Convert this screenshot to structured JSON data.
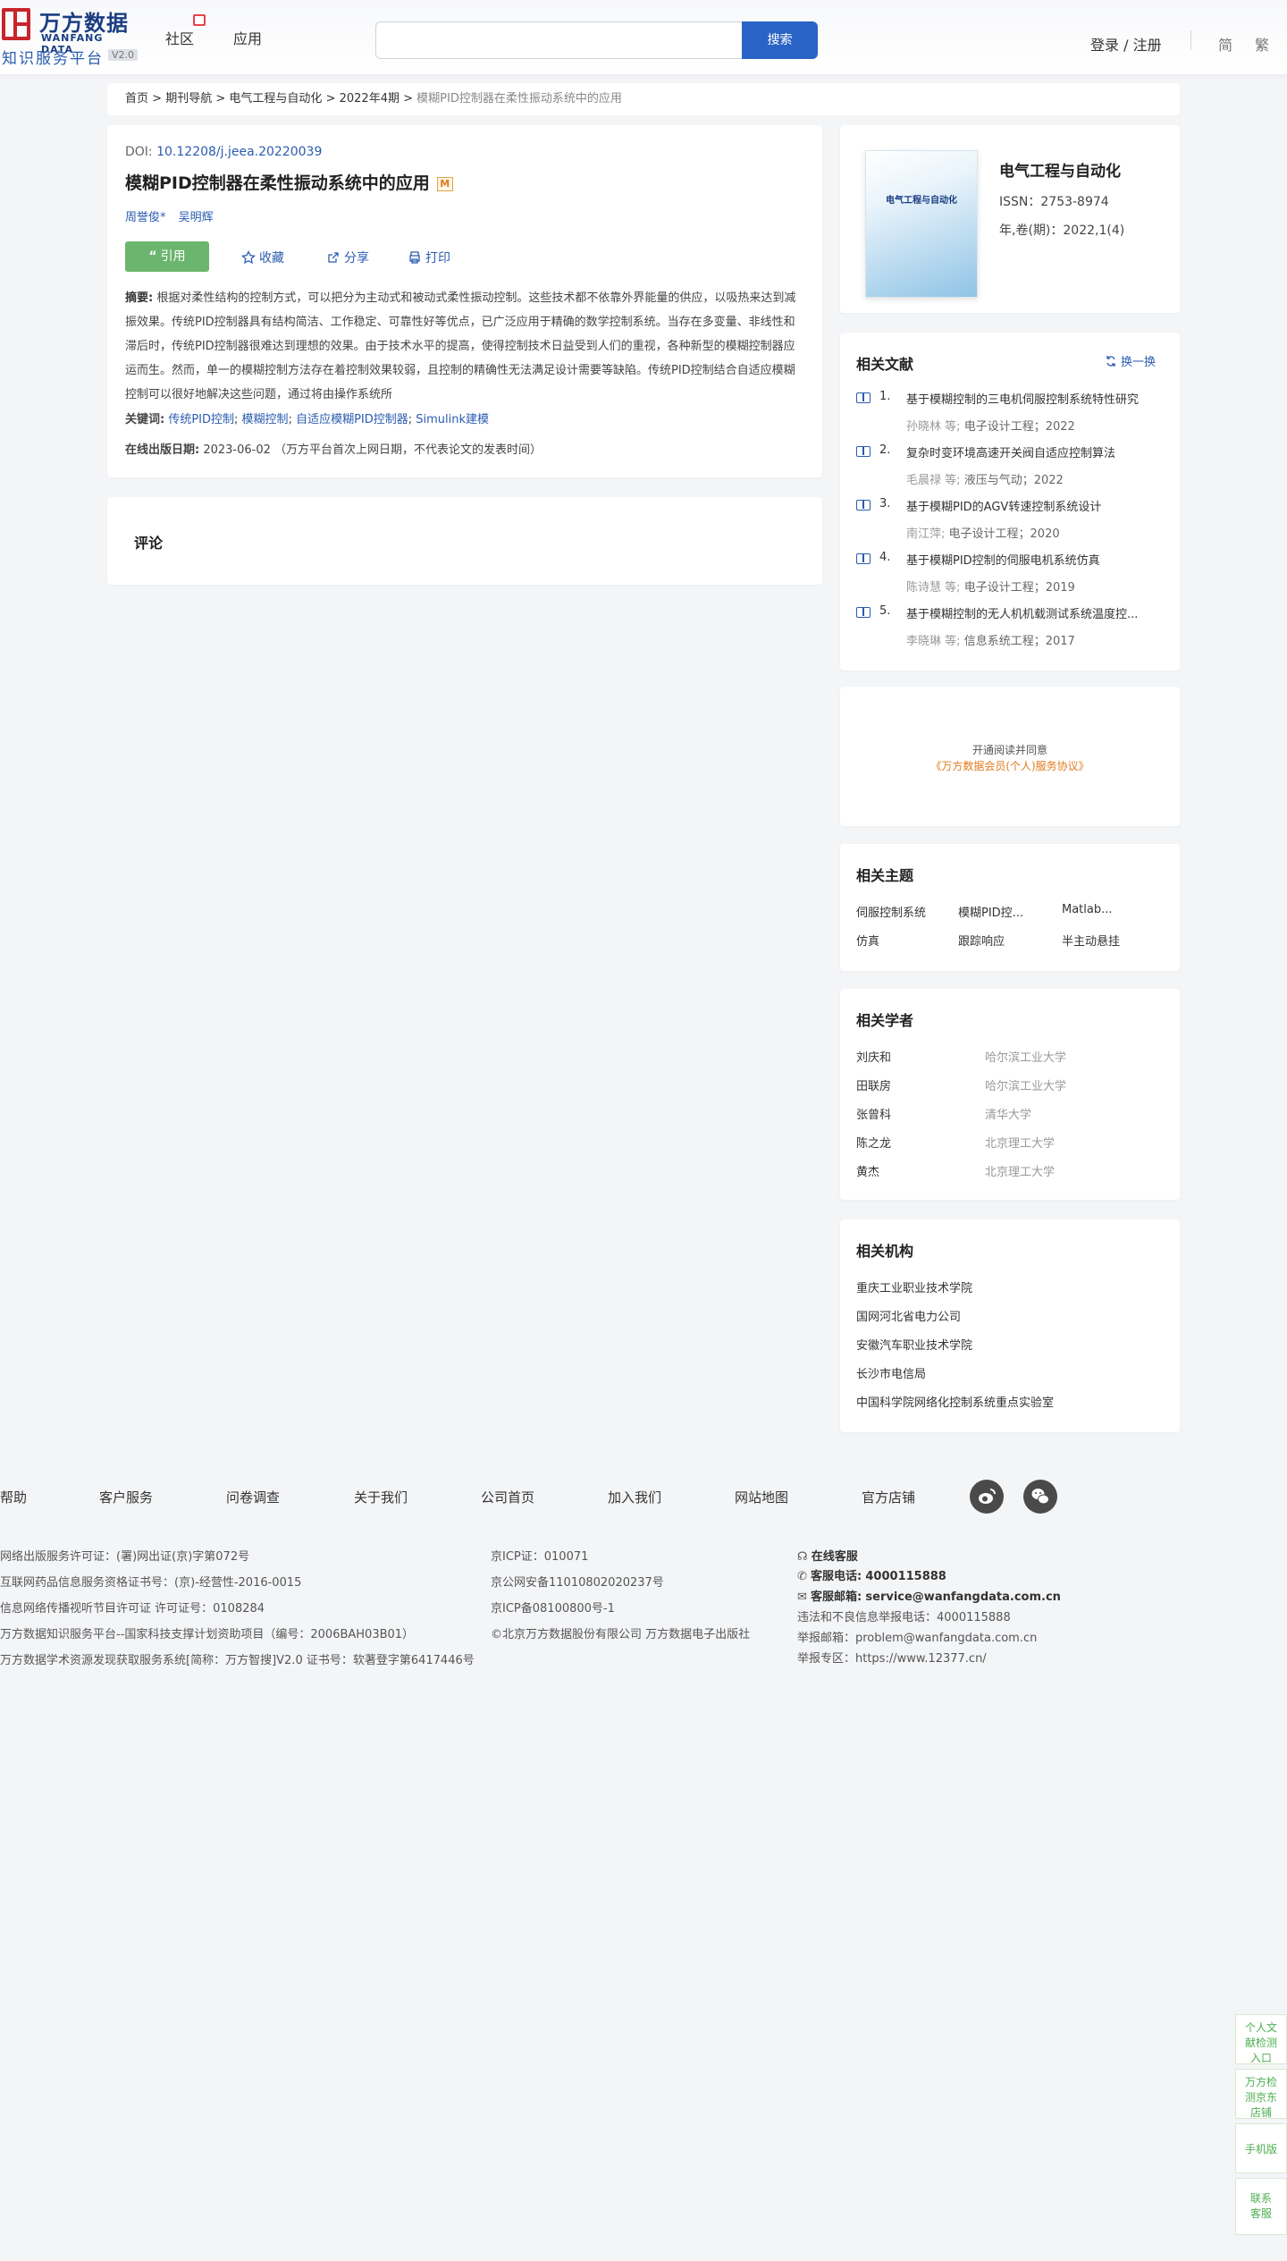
{
  "header": {
    "logo_cn": "万方数据",
    "logo_en": "WANFANG DATA",
    "logo_sub": "知识服务平台",
    "logo_version": "V2.0",
    "nav": [
      "社区",
      "应用"
    ],
    "search_placeholder": "",
    "search_button": "搜索",
    "login": "登录 / 注册",
    "lang_simplified": "简",
    "lang_traditional": "繁"
  },
  "breadcrumb": {
    "items": [
      "首页",
      "期刊导航",
      "电气工程与自动化",
      "2022年4期"
    ],
    "separator": ">",
    "current": "模糊PID控制器在柔性振动系统中的应用"
  },
  "article": {
    "doi_label": "DOI:",
    "doi": "10.12208/j.jeea.20220039",
    "title": "模糊PID控制器在柔性振动系统中的应用",
    "title_mark": "M",
    "authors": [
      "周誉俊*",
      "吴明辉"
    ],
    "actions": {
      "cite": "引用",
      "favorite": "收藏",
      "share": "分享",
      "print": "打印"
    },
    "abstract_label": "摘要:",
    "abstract": "根据对柔性结构的控制方式，可以把分为主动式和被动式柔性振动控制。这些技术都不依靠外界能量的供应，以吸热来达到减振效果。传统PID控制器具有结构简洁、工作稳定、可靠性好等优点，已广泛应用于精确的数学控制系统。当存在多变量、非线性和滞后时，传统PID控制器很难达到理想的效果。由于技术水平的提高，使得控制技术日益受到人们的重视，各种新型的模糊控制器应运而生。然而，单一的模糊控制方法存在着控制效果较弱，且控制的精确性无法满足设计需要等缺陷。传统PID控制结合自适应模糊控制可以很好地解决这些问题，通过将由操作系统所",
    "keywords_label": "关键词:",
    "keywords": [
      "传统PID控制",
      "模糊控制",
      "自适应模糊PID控制器",
      "Simulink建模"
    ],
    "pub_label": "在线出版日期:",
    "pub_date": "2023-06-02",
    "pub_note": "（万方平台首次上网日期，不代表论文的发表时间）"
  },
  "comments": {
    "title": "评论"
  },
  "journal": {
    "cover_text": "电气工程与自动化",
    "name": "电气工程与自动化",
    "issn": "ISSN：2753-8974",
    "volume": "年,卷(期)：2022,1(4)"
  },
  "related_docs": {
    "title": "相关文献",
    "swap": "换一换",
    "items": [
      {
        "num": "1.",
        "title": "基于模糊控制的三电机伺服控制系统特性研究",
        "author": "孙晓林",
        "etal": "等;",
        "source": "电子设计工程；2022"
      },
      {
        "num": "2.",
        "title": "复杂时变环境高速开关阀自适应控制算法",
        "author": "毛晨禄",
        "etal": "等;",
        "source": "液压与气动；2022"
      },
      {
        "num": "3.",
        "title": "基于模糊PID的AGV转速控制系统设计",
        "author": "南江萍;",
        "etal": "",
        "source": "电子设计工程；2020"
      },
      {
        "num": "4.",
        "title": "基于模糊PID控制的伺服电机系统仿真",
        "author": "陈诗慧",
        "etal": "等;",
        "source": "电子设计工程；2019"
      },
      {
        "num": "5.",
        "title": "基于模糊控制的无人机机载测试系统温度控...",
        "author": "李晓琳",
        "etal": "等;",
        "source": "信息系统工程；2017"
      }
    ]
  },
  "promo": {
    "line1": "开通阅读并同意",
    "line2": "《万方数据会员(个人)服务协议》"
  },
  "topics": {
    "title": "相关主题",
    "items": [
      "伺服控制系统",
      "模糊PID控...",
      "Matlab...",
      "仿真",
      "跟踪响应",
      "半主动悬挂"
    ]
  },
  "scholars": {
    "title": "相关学者",
    "items": [
      {
        "name": "刘庆和",
        "org": "哈尔滨工业大学"
      },
      {
        "name": "田联房",
        "org": "哈尔滨工业大学"
      },
      {
        "name": "张曾科",
        "org": "清华大学"
      },
      {
        "name": "陈之龙",
        "org": "北京理工大学"
      },
      {
        "name": "黄杰",
        "org": "北京理工大学"
      }
    ]
  },
  "institutions": {
    "title": "相关机构",
    "items": [
      "重庆工业职业技术学院",
      "国网河北省电力公司",
      "安徽汽车职业技术学院",
      "长沙市电信局",
      "中国科学院网络化控制系统重点实验室"
    ]
  },
  "footer": {
    "links": [
      "帮助",
      "客户服务",
      "问卷调查",
      "关于我们",
      "公司首页",
      "加入我们",
      "网站地图",
      "官方店铺"
    ],
    "col1": [
      "网络出版服务许可证：(署)网出证(京)字第072号",
      "互联网药品信息服务资格证书号：(京)-经营性-2016-0015",
      "信息网络传播视听节目许可证 许可证号：0108284",
      "万方数据知识服务平台--国家科技支撑计划资助项目（编号：2006BAH03B01）",
      "万方数据学术资源发现获取服务系统[简称：万方智搜]V2.0 证书号：软著登字第6417446号"
    ],
    "col2": [
      "京ICP证：010071",
      "京公网安备11010802020237号",
      "京ICP备08100800号-1",
      "©北京万方数据股份有限公司 万方数据电子出版社"
    ],
    "service_online": "在线客服",
    "phone_label": "客服电话:",
    "phone": "4000115888",
    "email_label": "客服邮箱:",
    "email": "service@wanfangdata.com.cn",
    "report_phone": "违法和不良信息举报电话：4000115888",
    "report_email": "举报邮箱：problem@wanfangdata.com.cn",
    "report_zone": "举报专区：https://www.12377.cn/"
  },
  "side_tabs": {
    "t1": "个人文献检测入口",
    "t2": "万方检测京东店铺",
    "t3": "手机版",
    "t4": "联系客服"
  },
  "icons": [
    "book-icon",
    "swap-icon",
    "star-icon",
    "share-icon",
    "print-icon",
    "weibo-icon",
    "wechat-icon",
    "headset-icon",
    "phone-icon",
    "mail-icon"
  ]
}
